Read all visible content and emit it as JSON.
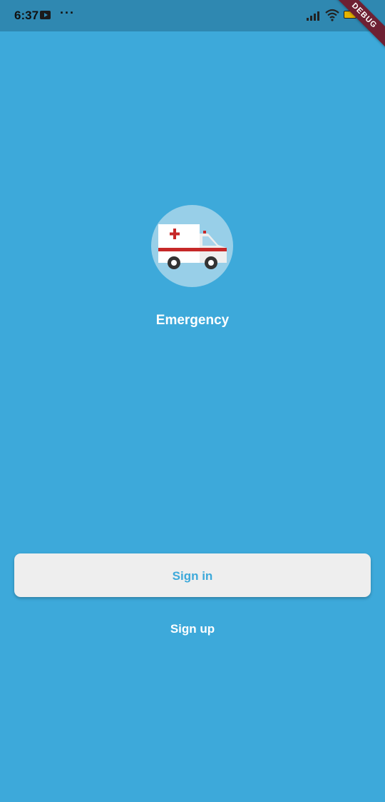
{
  "status_bar": {
    "time": "6:37",
    "dots": "···",
    "icons": [
      "youtube-icon",
      "more-dots-icon",
      "signal-icon",
      "wifi-icon",
      "battery-icon"
    ]
  },
  "debug_banner": "DEBUG",
  "app": {
    "logo_icon": "ambulance-icon",
    "title": "Emergency"
  },
  "actions": {
    "signin_label": "Sign in",
    "signup_label": "Sign up"
  },
  "colors": {
    "background": "#3DA9DA",
    "status_bar": "#2F88B1",
    "button_bg": "#EEEEEE",
    "button_text": "#3DA9DA",
    "debug_banner": "#6E2033"
  }
}
